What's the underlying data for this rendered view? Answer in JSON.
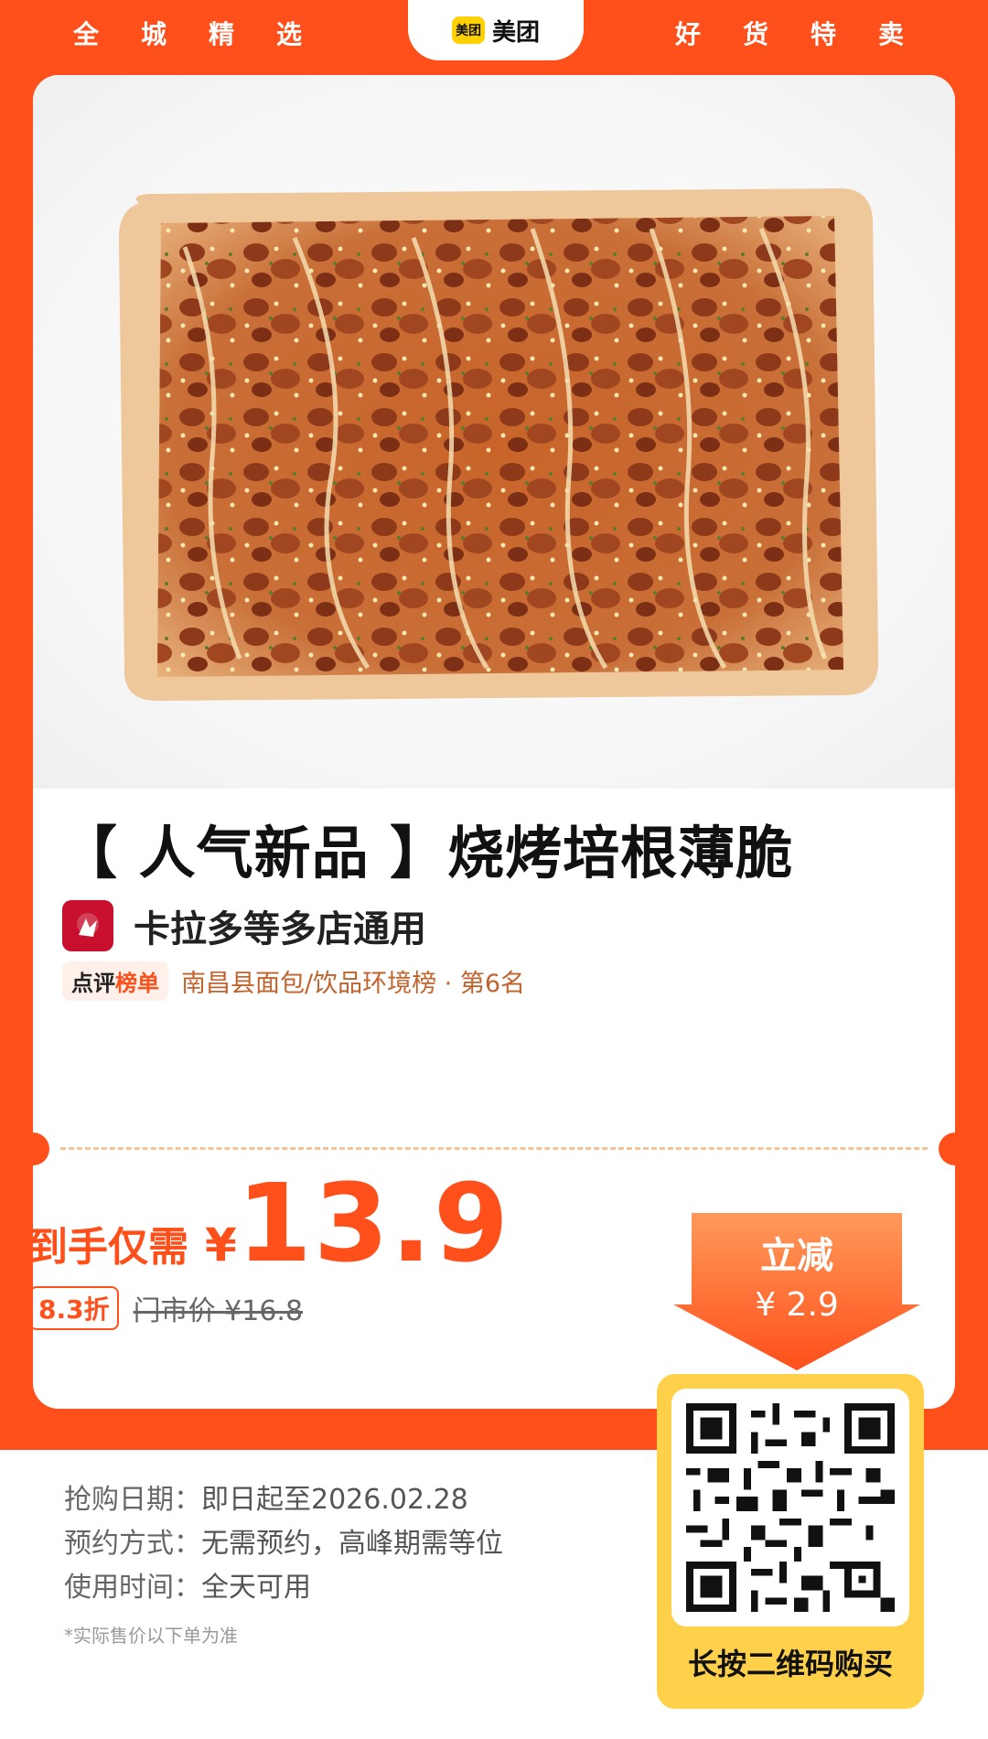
{
  "header": {
    "left_chars": [
      "全",
      "城",
      "精",
      "选"
    ],
    "right_chars": [
      "好",
      "货",
      "特",
      "卖"
    ],
    "logo_badge": "美团",
    "logo_text": "美团"
  },
  "product": {
    "title": "【 人气新品 】烧烤培根薄脆",
    "image_icon": "bbq-bacon-flatbread-image",
    "store_name": "卡拉多等多店通用",
    "store_logo_icon": "karadou-logo-icon",
    "rank_badge_prefix": "点评",
    "rank_badge_suffix": "榜单",
    "rank_text": "南昌县面包/饮品环境榜 · 第6名"
  },
  "pricing": {
    "label": "到手仅需",
    "symbol": "¥",
    "price": "13.9",
    "discount": "8.3折",
    "original_price": "门市价 ¥16.8",
    "arrow_title": "立减",
    "arrow_amount": "¥ 2.9"
  },
  "info": {
    "rows": [
      {
        "key": "抢购日期：",
        "value": "即日起至2026.02.28"
      },
      {
        "key": "预约方式：",
        "value": "无需预约，高峰期需等位"
      },
      {
        "key": "使用时间：",
        "value": "全天可用"
      }
    ],
    "note": "*实际售价以下单为准"
  },
  "qr": {
    "icon": "qr-code-icon",
    "label": "长按二维码购买"
  },
  "colors": {
    "brand_orange": "#ff4f1a",
    "meituan_yellow": "#ffd100",
    "qr_frame": "#ffd04a"
  }
}
